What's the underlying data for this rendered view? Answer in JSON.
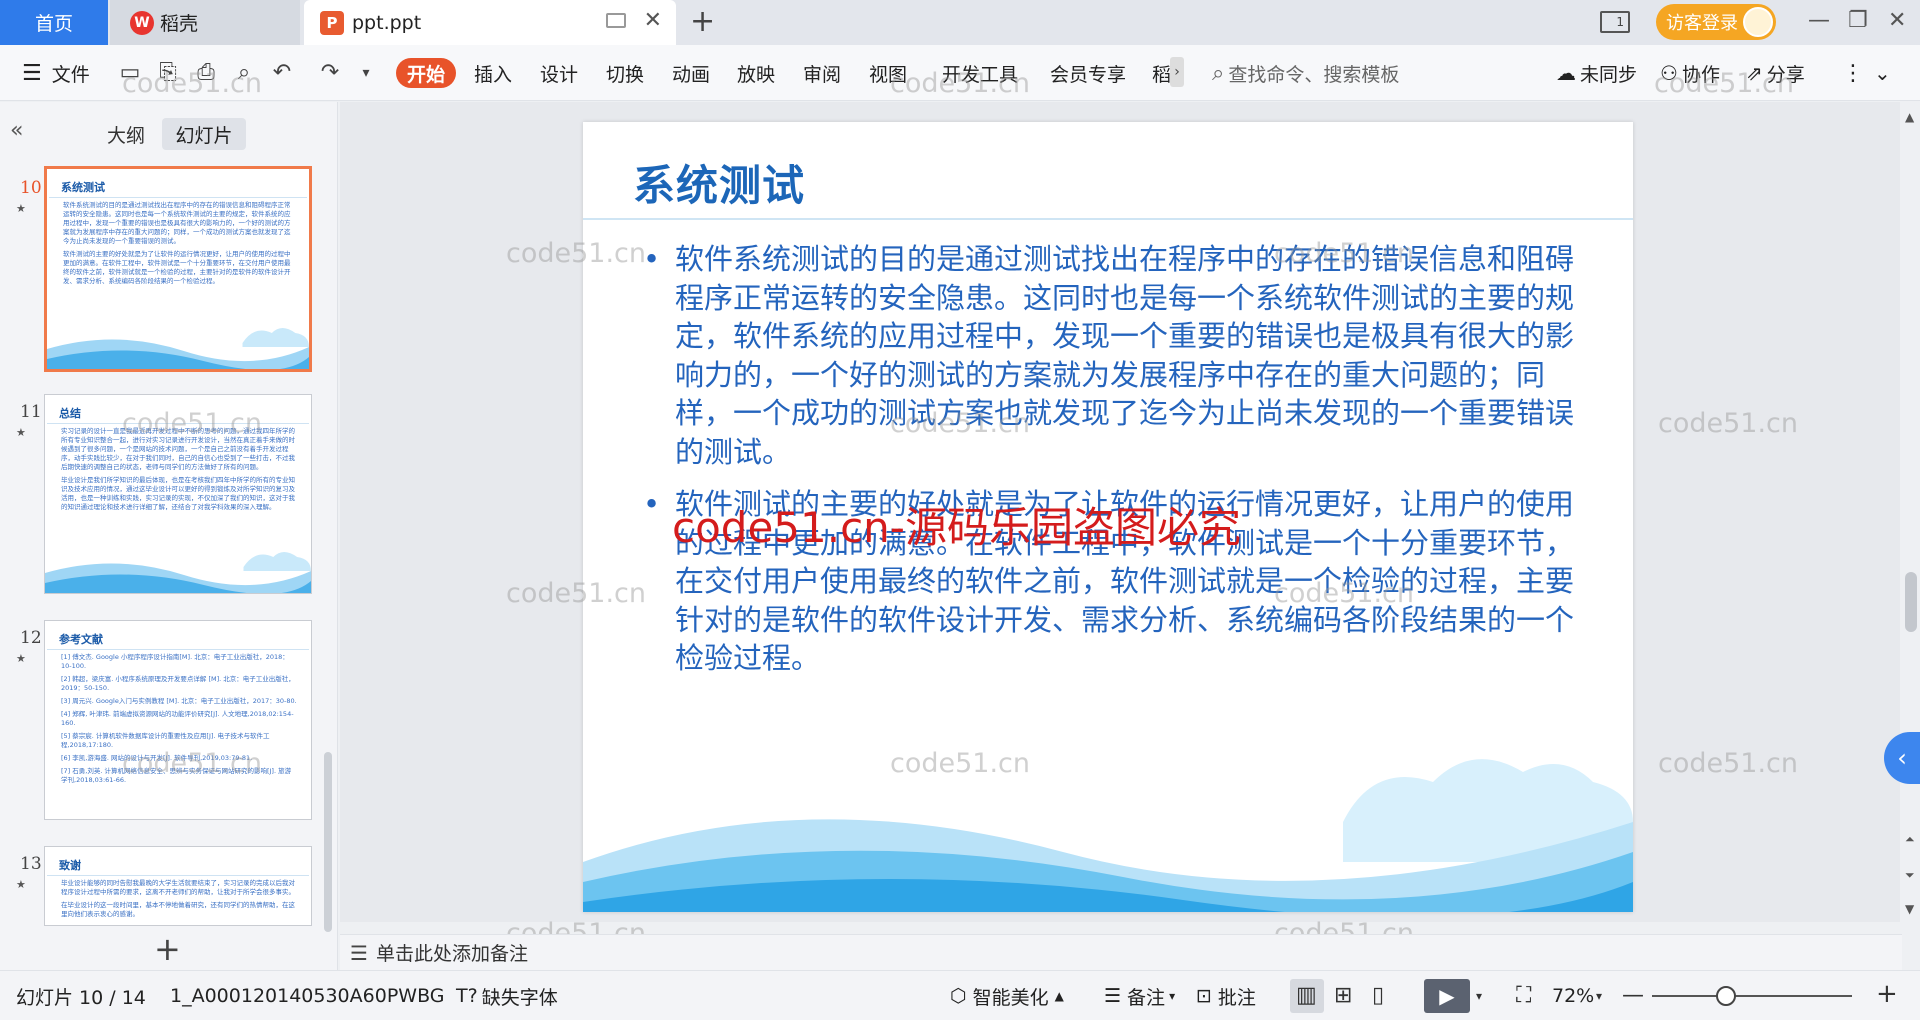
{
  "tabs": {
    "home": "首页",
    "daoke": "稻壳",
    "doc": "ppt.ppt"
  },
  "account": {
    "login": "访客登录"
  },
  "ribbon": {
    "file": "文件",
    "tabs": [
      "开始",
      "插入",
      "设计",
      "切换",
      "动画",
      "放映",
      "审阅",
      "视图",
      "开发工具",
      "会员专享",
      "稻"
    ],
    "search_placeholder": "查找命令、搜索模板",
    "sync": "未同步",
    "collab": "协作",
    "share": "分享"
  },
  "panel": {
    "outline": "大纲",
    "slides": "幻灯片"
  },
  "thumbnails": [
    {
      "num": "10",
      "title": "系统测试",
      "texts": [
        "软件系统测试的目的是通过测试找出在程序中的存在的错误信息和阻碍程序正常运转的安全隐患。这同时也是每一个系统软件测试的主要的规定，软件系统的应用过程中，发现一个重要的错误也是极具有很大的影响力的，一个好的测试的方案就为发展程序中存在的重大问题的；同样，一个成功的测试方案也就发现了迄今为止尚未发现的一个重要错误的测试。",
        "软件测试的主要的好处就是为了让软件的运行情况更好，让用户的使用的过程中更加的满意。在软件工程中，软件测试是一个十分重要环节，在交付用户使用最终的软件之前，软件测试就是一个检验的过程，主要针对的是软件的软件设计开发、需求分析、系统编码各阶段结果的一个检验过程。"
      ]
    },
    {
      "num": "11",
      "title": "总结",
      "texts": [
        "实习记录的设计一直是我最近再开发过程中不断的思考的问题，通过我四年所学的所有专业知识整合一起，进行对实习记录进行开发设计，当然在真正着手来做的时候遇到了很多问题，一个是网站的技术问题，一个是自己之前没有着手开发过程序，动手实践比较少，在对于我们同时，自己的自信心也受到了一些打击，不过我后期快速的调整自己的状态，老师与同学们的方法做好了所有的问题。",
        "毕业设计是我们所学知识的最后体现，也是在考核我们四年中所学的所有的专业知识及技术应用的情况，通过这毕业设计可以更好的得到锻炼及对所学知识的复习及活用，也是一种训练和实践，实习记录的实现，不仅加深了我们的知识，这对于我的知识通过理论和技术进行详细了解，还结合了对我学科效果的深入理解。"
      ]
    },
    {
      "num": "12",
      "title": "参考文献",
      "texts": [
        "[1] 傅文杰. Google 小程序程序设计指南[M]. 北京：电子工业出版社，2018：10-100.",
        "[2] 韩超，梁庆富. 小程序系统原理及开发要点详解 [M]. 北京：电子工业出版社，2019：50-150.",
        "[3] 周元兴. Google入门与实例教程 [M]. 北京：电子工业出版社，2017：30-80.",
        "[4] 郑辉, 叶津玮. 前端虚拟资源网站的功能评价研究[J]. 人文地理,2018,02:154-160.",
        "[5] 蔡宗宸. 计算机软件数据库设计的重要性及应用[J]. 电子技术与软件工程,2018,17:180.",
        "[6] 李凯,游海盛. 网站的设计与开发[J]. 软件导刊,2019,03:79-81.",
        "[7] 石勇,刘英. 计算机网络信息安全、思辨与实务保证与网站研究的影响[J]. 旅游学刊,2018,03:61-66."
      ]
    },
    {
      "num": "13",
      "title": "致谢",
      "texts": [
        "毕业设计能够的同时告慰我最晚的大学生活就要结束了，实习记录的完成以后我对程序设计过程中所需的要求，这离不开老师们的帮助，让我对于所学会很多事实。",
        "在毕业设计的这一段时间里，基本不停地做着研究，还有同学们的热情帮助，在这里向他们表示衷心的感谢。"
      ]
    }
  ],
  "slide": {
    "title": "系统测试",
    "bullets": [
      "软件系统测试的目的是通过测试找出在程序中的存在的错误信息和阻碍程序正常运转的安全隐患。这同时也是每一个系统软件测试的主要的规定，软件系统的应用过程中，发现一个重要的错误也是极具有很大的影响力的，一个好的测试的方案就为发展程序中存在的重大问题的；同样，一个成功的测试方案也就发现了迄今为止尚未发现的一个重要错误的测试。",
      "软件测试的主要的好处就是为了让软件的运行情况更好，让用户的使用的过程中更加的满意。在软件工程中，软件测试是一个十分重要环节，在交付用户使用最终的软件之前，软件测试就是一个检验的过程，主要针对的是软件的软件设计开发、需求分析、系统编码各阶段结果的一个检验过程。"
    ]
  },
  "watermark": {
    "text": "code51.cn",
    "red": "code51.cn-源码乐园盗图必究"
  },
  "notes": {
    "placeholder": "单击此处添加备注"
  },
  "status": {
    "slide_counter": "幻灯片 10 / 14",
    "template": "1_A000120140530A60PWBG",
    "missing_font": "缺失字体",
    "beautify": "智能美化",
    "notes": "备注",
    "comment": "批注",
    "zoom": "72%"
  },
  "colors": {
    "accent_orange": "#e8532a",
    "home_tab_blue": "#2f7bea",
    "slide_title": "#1c66b8",
    "slide_text": "#2464bd",
    "login_bg": "#f5a623"
  }
}
